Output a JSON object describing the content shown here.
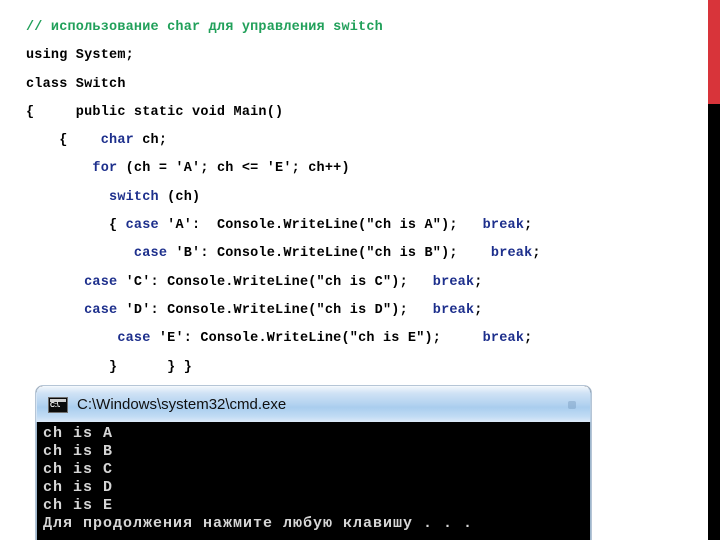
{
  "slide": {
    "background_color": "#ffffff",
    "accent_red": "#d8343a",
    "accent_black": "#000000",
    "comment_green": "#21a05a",
    "keyword_blue": "#1d2f8c"
  },
  "code": {
    "language": "csharp",
    "lines": [
      {
        "text": "// использование char для управления switch",
        "style": "comment"
      },
      {
        "text": "using System;",
        "style": "normal"
      },
      {
        "text": "class Switch",
        "style": "normal"
      },
      {
        "text": "{     public static void Main()",
        "style": "normal"
      },
      {
        "text": "    {    char ch;",
        "style": "normal"
      },
      {
        "text": "        for (ch = 'A'; ch <= 'E'; ch++)",
        "style": "normal"
      },
      {
        "text": "          switch (ch)",
        "style": "normal"
      },
      {
        "text": "          { case 'A':  Console.WriteLine(\"ch is A\");   break;",
        "style": "normal"
      },
      {
        "text": "             case 'B': Console.WriteLine(\"ch is B\");    break;",
        "style": "normal"
      },
      {
        "text": "       case 'C': Console.WriteLine(\"ch is C\");   break;",
        "style": "normal"
      },
      {
        "text": "       case 'D': Console.WriteLine(\"ch is D\");   break;",
        "style": "normal"
      },
      {
        "text": "           case 'E': Console.WriteLine(\"ch is E\");     break;",
        "style": "normal"
      },
      {
        "text": "          }      } }",
        "style": "normal"
      }
    ]
  },
  "console": {
    "title": "C:\\Windows\\system32\\cmd.exe",
    "icon": "cmd-window-icon",
    "output_lines": [
      "ch is A",
      "ch is B",
      "ch is C",
      "ch is D",
      "ch is E",
      "Для продолжения нажмите любую клавишу . . ."
    ]
  }
}
